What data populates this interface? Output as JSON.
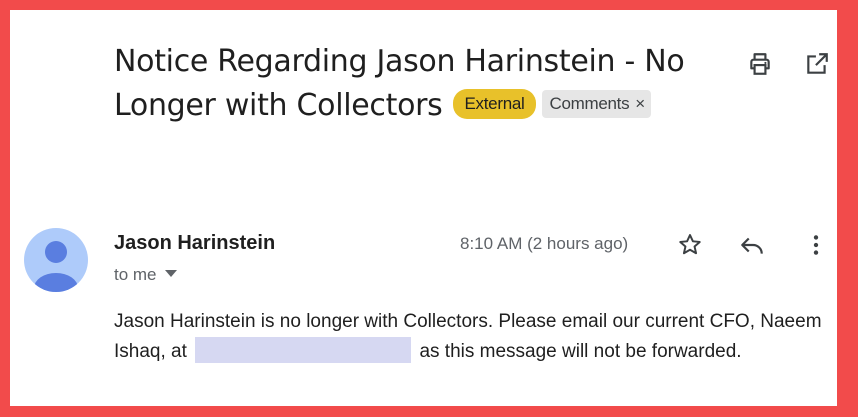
{
  "email": {
    "subject": "Notice Regarding Jason Harinstein - No Longer with Collectors",
    "labels": {
      "external": "External",
      "comments": "Comments",
      "comments_remove": "×"
    },
    "sender_name": "Jason Harinstein",
    "recipient_line": "to me",
    "timestamp": "8:10 AM (2 hours ago)",
    "body_part1": "Jason Harinstein is no longer with Collectors. Please email our current CFO, Naeem Ishaq, at",
    "body_part2": "as this message will not be forwarded."
  },
  "icons": {
    "print": "print-icon",
    "open_new_window": "open-in-new-icon",
    "star": "star-icon",
    "reply": "reply-icon",
    "more": "more-vert-icon",
    "dropdown": "caret-down-icon"
  },
  "colors": {
    "frame": "#f24b4b",
    "external_chip": "#e8c12a",
    "comments_chip": "#e6e6e6",
    "avatar": "#aecbfa",
    "avatar_figure": "#5a7ee0",
    "redaction": "#d6d8f2"
  }
}
